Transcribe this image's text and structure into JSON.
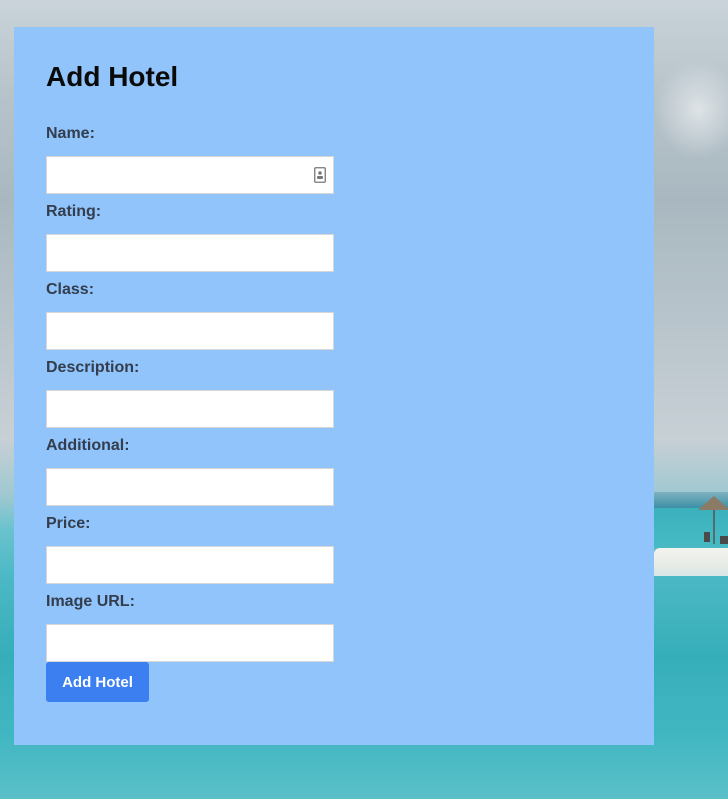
{
  "page": {
    "title": "Add Hotel"
  },
  "form": {
    "fields": [
      {
        "label": "Name:",
        "value": "",
        "placeholder": "",
        "icon": "autofill-contact-icon"
      },
      {
        "label": "Rating:",
        "value": "",
        "placeholder": ""
      },
      {
        "label": "Class:",
        "value": "",
        "placeholder": ""
      },
      {
        "label": "Description:",
        "value": "",
        "placeholder": ""
      },
      {
        "label": "Additional:",
        "value": "",
        "placeholder": ""
      },
      {
        "label": "Price:",
        "value": "",
        "placeholder": ""
      },
      {
        "label": "Image URL:",
        "value": "",
        "placeholder": ""
      }
    ],
    "submit_label": "Add Hotel"
  },
  "colors": {
    "panel_background": "#90c4fa",
    "button_background": "#3c7ff0",
    "label_color": "#333d4d"
  },
  "background": {
    "description_icon": "beach-umbrella-icon"
  }
}
